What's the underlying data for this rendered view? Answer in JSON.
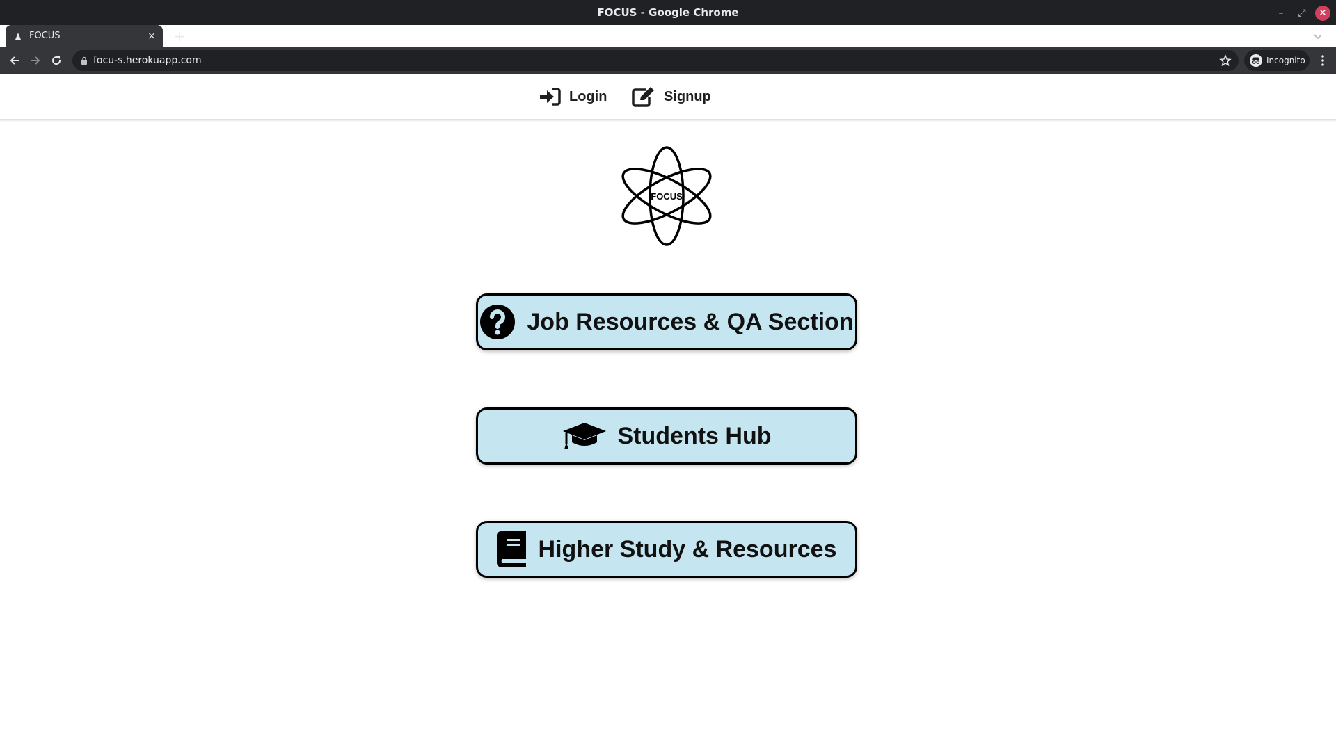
{
  "window": {
    "title": "FOCUS - Google Chrome"
  },
  "tab": {
    "title": "FOCUS",
    "close_glyph": "×",
    "new_tab_glyph": "+"
  },
  "address_bar": {
    "url": "focu-s.herokuapp.com"
  },
  "profile": {
    "label": "Incognito"
  },
  "window_controls": {
    "minimize": "–",
    "maximize": "⤢",
    "close": "✕"
  },
  "nav": {
    "login_label": "Login",
    "signup_label": "Signup"
  },
  "logo": {
    "text": "FOCUS"
  },
  "buttons": [
    {
      "label": "Job Resources & QA Section",
      "icon": "question-circle-icon"
    },
    {
      "label": "Students Hub",
      "icon": "graduation-cap-icon"
    },
    {
      "label": "Higher Study & Resources",
      "icon": "book-icon"
    }
  ],
  "colors": {
    "button_bg": "#c5e5f1",
    "chrome_dark": "#202124",
    "chrome_toolbar": "#35363a",
    "close_button": "#d23f5e"
  }
}
